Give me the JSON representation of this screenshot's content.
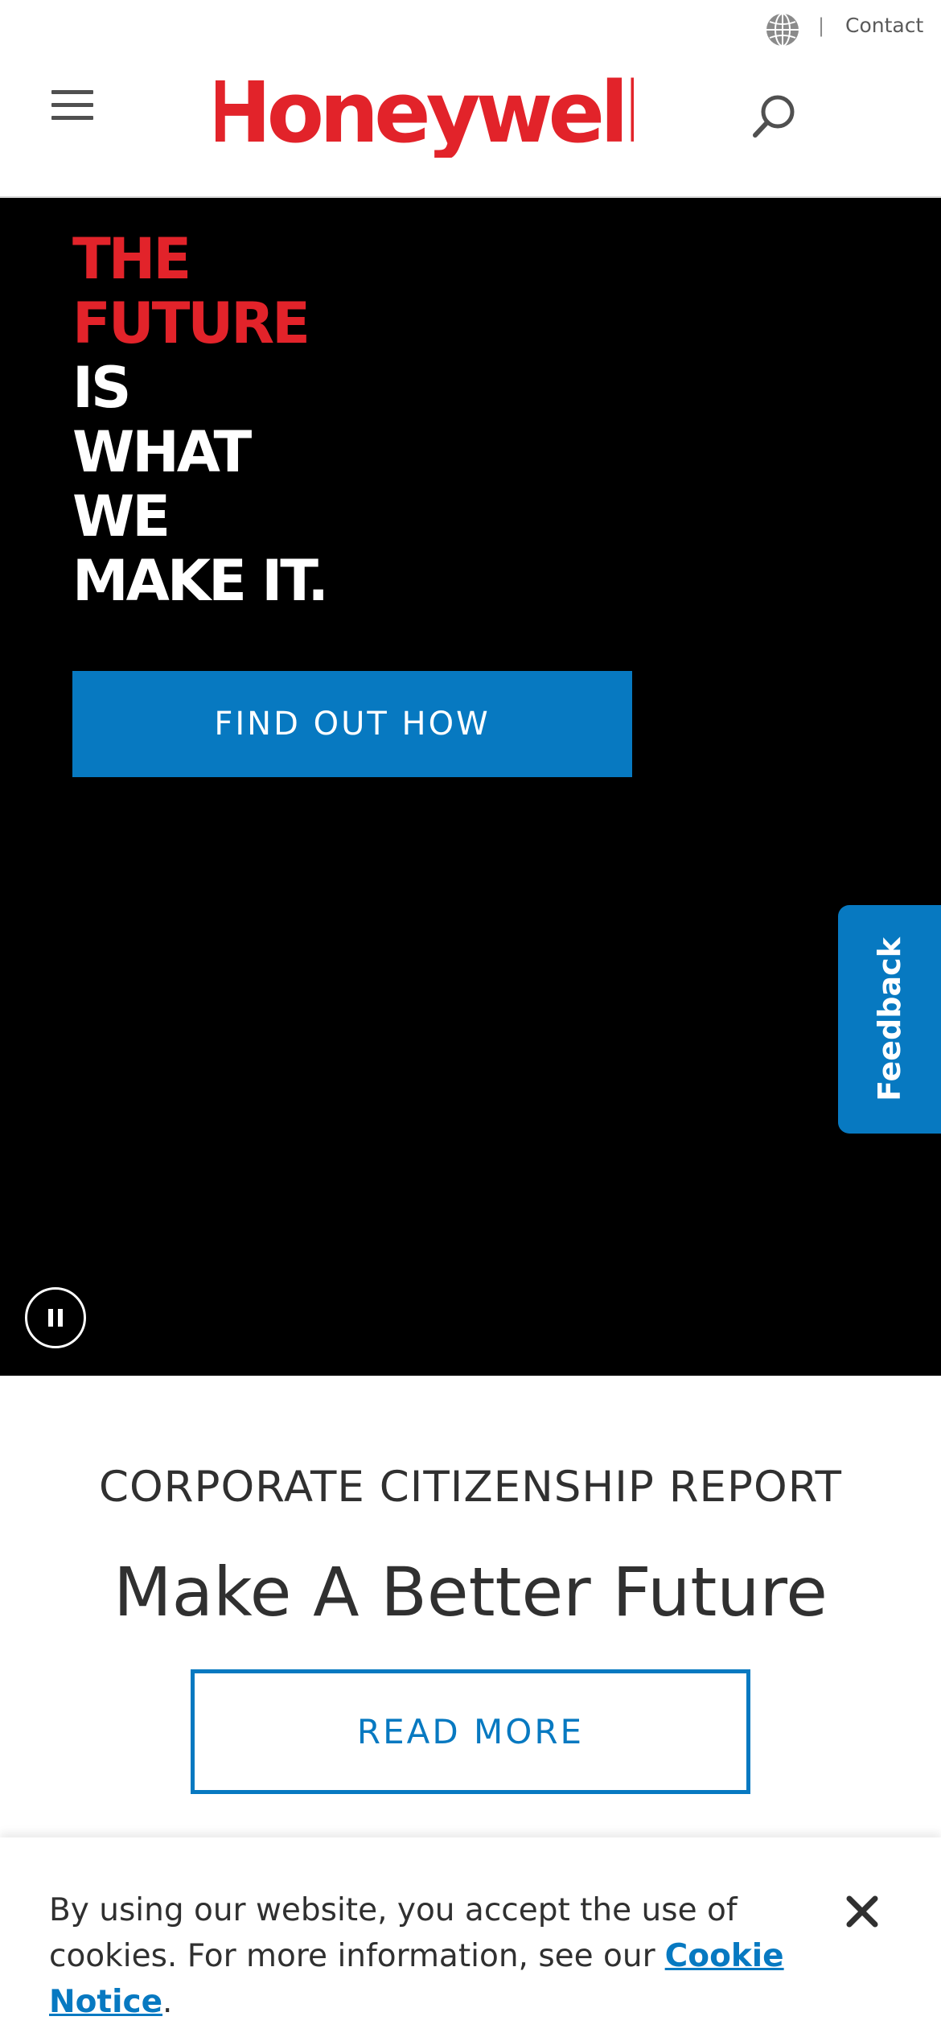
{
  "utility": {
    "separator": "|",
    "contact_label": "Contact"
  },
  "header": {
    "brand": "Honeywell"
  },
  "hero": {
    "lines": [
      "THE",
      "FUTURE",
      "IS",
      "WHAT",
      "WE",
      "MAKE IT."
    ],
    "cta_label": "FIND OUT HOW"
  },
  "feedback_label": "Feedback",
  "corporate": {
    "label": "CORPORATE CITIZENSHIP REPORT",
    "title": "Make A Better Future",
    "button_label": "READ MORE"
  },
  "cookie": {
    "text": "By using our website, you accept the use of cookies. For more information, see our",
    "link_label": "Cookie Notice",
    "end": "."
  },
  "colors": {
    "brand_red": "#e2232a",
    "accent_blue": "#0779c1",
    "hero_bg": "#000000"
  },
  "icons": [
    "globe-icon",
    "hamburger-menu-icon",
    "search-icon",
    "pause-icon",
    "close-icon"
  ]
}
